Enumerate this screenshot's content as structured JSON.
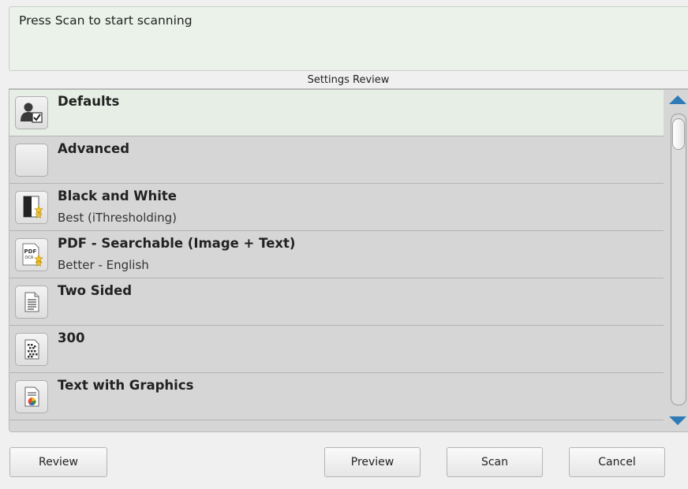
{
  "status": {
    "message": "Press Scan to start scanning"
  },
  "settings_review": {
    "title": "Settings Review",
    "items": [
      {
        "title": "Defaults",
        "subtitle": "",
        "icon": "user-settings-icon",
        "selected": true
      },
      {
        "title": "Advanced",
        "subtitle": "",
        "icon": "blank-icon",
        "selected": false
      },
      {
        "title": "Black and White",
        "subtitle": "Best (iThresholding)",
        "icon": "black-white-star-icon",
        "selected": false
      },
      {
        "title": "PDF - Searchable (Image + Text)",
        "subtitle": "Better - English",
        "icon": "pdf-ocr-icon",
        "icon_text": "PDF OCR",
        "selected": false
      },
      {
        "title": "Two Sided",
        "subtitle": "",
        "icon": "document-icon",
        "selected": false
      },
      {
        "title": "300",
        "subtitle": "",
        "icon": "resolution-grid-icon",
        "selected": false
      },
      {
        "title": "Text with Graphics",
        "subtitle": "",
        "icon": "document-chart-icon",
        "selected": false
      }
    ]
  },
  "buttons": {
    "review": "Review",
    "preview": "Preview",
    "scan": "Scan",
    "cancel": "Cancel"
  },
  "colors": {
    "status_bg": "#eaf2ea",
    "list_bg": "#d6d6d6",
    "selected_row_bg": "#e6eee6",
    "scroll_arrow": "#2e7bb8"
  }
}
